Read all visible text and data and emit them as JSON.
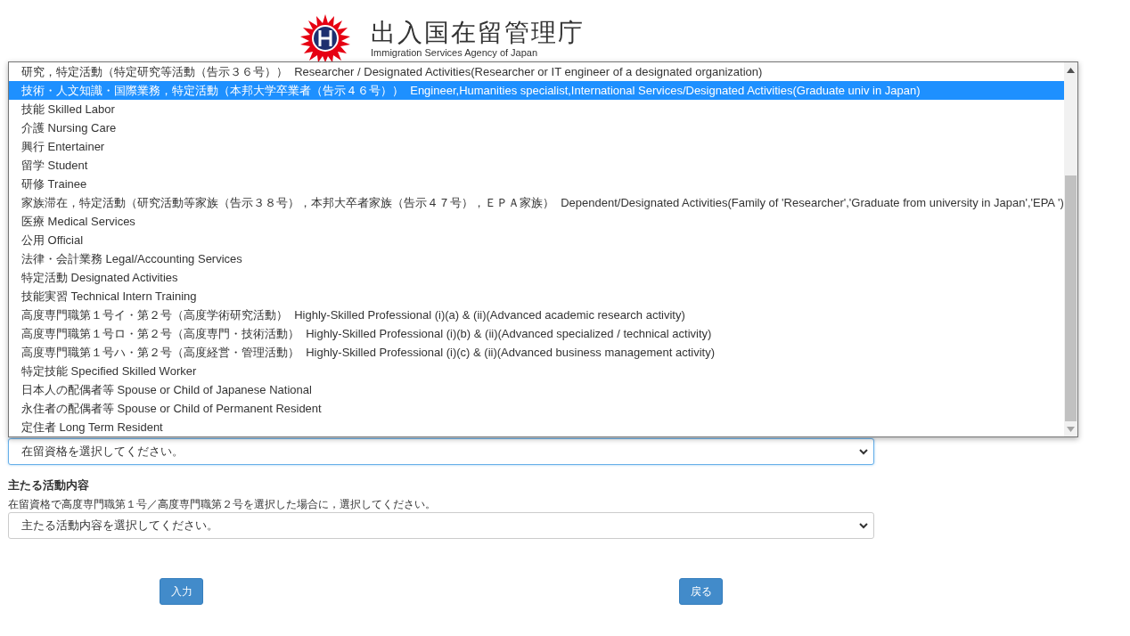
{
  "header": {
    "title": "出入国在留管理庁",
    "subtitle": "Immigration Services Agency of Japan"
  },
  "status_select": {
    "value": "在留資格を選択してください。",
    "expanded": true,
    "options": [
      {
        "label": "研究，特定活動（特定研究等活動（告示３６号））  Researcher / Designated Activities(Researcher or IT engineer of a designated organization)",
        "selected": false
      },
      {
        "label": "技術・人文知識・国際業務，特定活動（本邦大学卒業者（告示４６号））  Engineer,Humanities specialist,International Services/Designated Activities(Graduate univ in Japan)",
        "selected": true
      },
      {
        "label": "技能 Skilled Labor",
        "selected": false
      },
      {
        "label": "介護 Nursing Care",
        "selected": false
      },
      {
        "label": "興行 Entertainer",
        "selected": false
      },
      {
        "label": "留学 Student",
        "selected": false
      },
      {
        "label": "研修 Trainee",
        "selected": false
      },
      {
        "label": "家族滞在，特定活動（研究活動等家族（告示３８号），本邦大卒者家族（告示４７号），ＥＰＡ家族）  Dependent/Designated Activities(Family of 'Researcher','Graduate from university in Japan','EPA ')",
        "selected": false
      },
      {
        "label": "医療 Medical Services",
        "selected": false
      },
      {
        "label": "公用 Official",
        "selected": false
      },
      {
        "label": "法律・会計業務 Legal/Accounting Services",
        "selected": false
      },
      {
        "label": "特定活動 Designated Activities",
        "selected": false
      },
      {
        "label": "技能実習 Technical Intern Training",
        "selected": false
      },
      {
        "label": "高度専門職第１号イ・第２号（高度学術研究活動）  Highly-Skilled Professional (i)(a) & (ii)(Advanced academic research activity)",
        "selected": false
      },
      {
        "label": "高度専門職第１号ロ・第２号（高度専門・技術活動）  Highly-Skilled Professional (i)(b) & (ii)(Advanced specialized / technical activity)",
        "selected": false
      },
      {
        "label": "高度専門職第１号ハ・第２号（高度経営・管理活動）  Highly-Skilled Professional (i)(c) & (ii)(Advanced business management activity)",
        "selected": false
      },
      {
        "label": "特定技能 Specified Skilled Worker",
        "selected": false
      },
      {
        "label": "日本人の配偶者等 Spouse or Child of Japanese National",
        "selected": false
      },
      {
        "label": "永住者の配偶者等 Spouse or Child of Permanent Resident",
        "selected": false
      },
      {
        "label": "定住者 Long Term Resident",
        "selected": false
      }
    ]
  },
  "activity": {
    "label": "主たる活動内容",
    "hint": "在留資格で高度専門職第１号／高度専門職第２号を選択した場合に，選択してください。",
    "value": "主たる活動内容を選択してください。"
  },
  "buttons": [
    "入力",
    "戻る"
  ]
}
